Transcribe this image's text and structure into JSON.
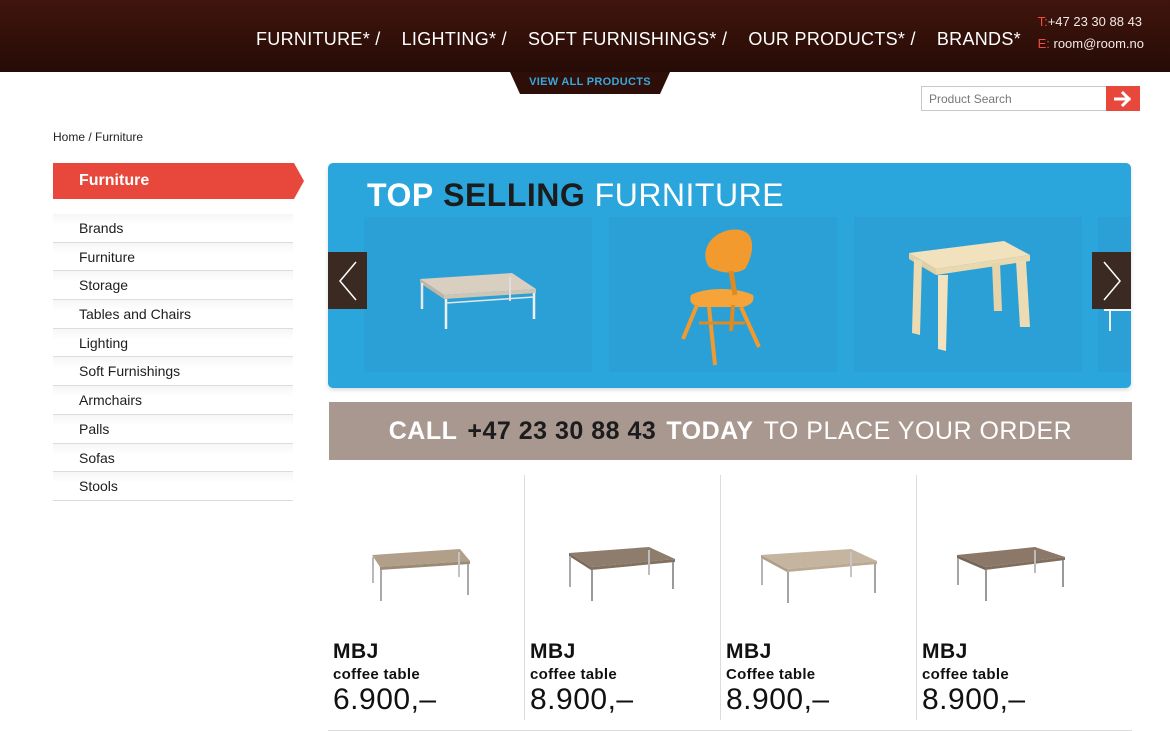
{
  "header": {
    "nav": [
      "FURNITURE* /",
      "LIGHTING* /",
      "SOFT FURNISHINGS* /",
      "OUR PRODUCTS* /",
      "BRANDS*"
    ],
    "contact": {
      "phone_key": "T:",
      "phone": "+47 23 30 88 43",
      "email_key": "E:",
      "email": "room@room.no"
    },
    "view_all": "VIEW ALL PRODUCTS"
  },
  "search": {
    "placeholder": "Product Search",
    "value": ""
  },
  "breadcrumb": {
    "home": "Home",
    "sep": " / ",
    "current": "Furniture"
  },
  "sidebar": {
    "heading": "Furniture",
    "items": [
      "Brands",
      "Furniture",
      "Storage",
      "Tables and Chairs",
      "Lighting",
      "Soft Furnishings",
      "Armchairs",
      "Palls",
      "Sofas",
      "Stools"
    ]
  },
  "carousel": {
    "title_a": "TOP",
    "title_b": "SELLING",
    "title_c": "FURNITURE"
  },
  "call_banner": {
    "w1": "CALL",
    "number": "+47 23 30 88 43",
    "w2": "TODAY",
    "rest": "TO PLACE YOUR ORDER"
  },
  "products": [
    {
      "brand": "MBJ",
      "type": "coffee table",
      "price": "6.900,–"
    },
    {
      "brand": "MBJ",
      "type": "coffee table",
      "price": "8.900,–"
    },
    {
      "brand": "MBJ",
      "type": "Coffee table",
      "price": "8.900,–"
    },
    {
      "brand": "MBJ",
      "type": "coffee table",
      "price": "8.900,–"
    }
  ],
  "colors": {
    "header_bg": "#2e0e08",
    "accent_red": "#e8483c",
    "carousel_blue": "#2ba6dd",
    "banner_taupe": "#a99890",
    "link_blue": "#39a8dc"
  }
}
